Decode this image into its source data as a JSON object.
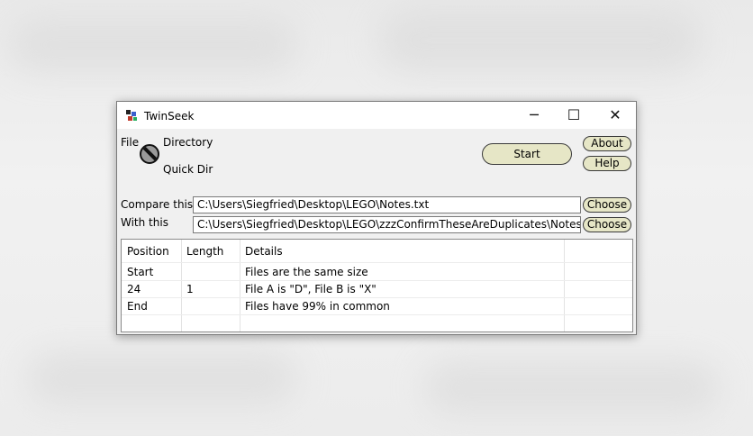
{
  "window": {
    "title": "TwinSeek",
    "controls": {
      "minimize": "─",
      "maximize": "☐",
      "close": "✕"
    }
  },
  "mode": {
    "file_label": "File",
    "directory_label": "Directory",
    "quick_dir_label": "Quick Dir"
  },
  "buttons": {
    "start": "Start",
    "about": "About",
    "help": "Help",
    "choose": "Choose"
  },
  "compare": {
    "label": "Compare this",
    "path": "C:\\Users\\Siegfried\\Desktop\\LEGO\\Notes.txt"
  },
  "with": {
    "label": "With this",
    "path": "C:\\Users\\Siegfried\\Desktop\\LEGO\\zzzConfirmTheseAreDuplicates\\Notes.txt"
  },
  "results": {
    "columns": [
      "Position",
      "Length",
      "Details"
    ],
    "rows": [
      {
        "position": "Start",
        "length": "",
        "details": "Files are the same size"
      },
      {
        "position": "24",
        "length": "1",
        "details": "File A is \"D\", File B is \"X\""
      },
      {
        "position": "End",
        "length": "",
        "details": "Files have 99% in common"
      }
    ]
  },
  "colors": {
    "button_fill": "#e6e6c6",
    "window_bg": "#f0f0f0",
    "titlebar_bg": "#ffffff"
  }
}
